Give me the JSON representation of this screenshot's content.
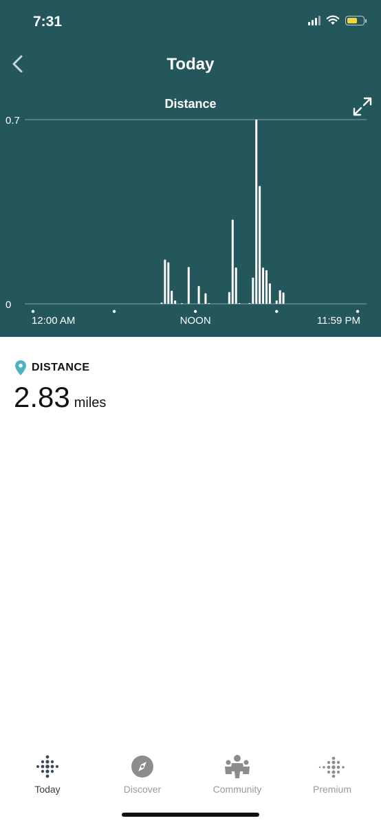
{
  "status_bar": {
    "time": "7:31"
  },
  "header": {
    "title": "Today"
  },
  "chart_data": {
    "type": "bar",
    "title": "Distance",
    "ylabel": "",
    "xlabel": "",
    "y_ticks": [
      "0.7",
      "0"
    ],
    "ylim": [
      0,
      0.7
    ],
    "x_tick_labels": [
      "12:00 AM",
      "NOON",
      "11:59 PM"
    ],
    "x_range_minutes": [
      0,
      1439
    ],
    "x_unit": "minutes since midnight",
    "bar_interval_minutes": 15,
    "x": [
      570,
      585,
      600,
      615,
      630,
      660,
      690,
      735,
      765,
      780,
      870,
      885,
      900,
      915,
      960,
      975,
      990,
      1005,
      1020,
      1035,
      1050,
      1080,
      1095,
      1110
    ],
    "values": [
      0.005,
      0.168,
      0.158,
      0.05,
      0.013,
      0.002,
      0.14,
      0.068,
      0.04,
      0.002,
      0.045,
      0.32,
      0.138,
      0.002,
      0.003,
      0.1,
      0.7,
      0.448,
      0.138,
      0.128,
      0.078,
      0.013,
      0.052,
      0.043
    ],
    "grid": true,
    "colors": {
      "background": "#23575c",
      "bars": "#ffffff"
    }
  },
  "metric": {
    "label": "DISTANCE",
    "value": "2.83",
    "unit": "miles",
    "accent_color": "#4fb3bf"
  },
  "tabs": [
    {
      "label": "Today",
      "icon": "fitbit-dots-icon",
      "active": true
    },
    {
      "label": "Discover",
      "icon": "compass-icon",
      "active": false
    },
    {
      "label": "Community",
      "icon": "community-people-icon",
      "active": false
    },
    {
      "label": "Premium",
      "icon": "premium-dots-icon",
      "active": false
    }
  ]
}
